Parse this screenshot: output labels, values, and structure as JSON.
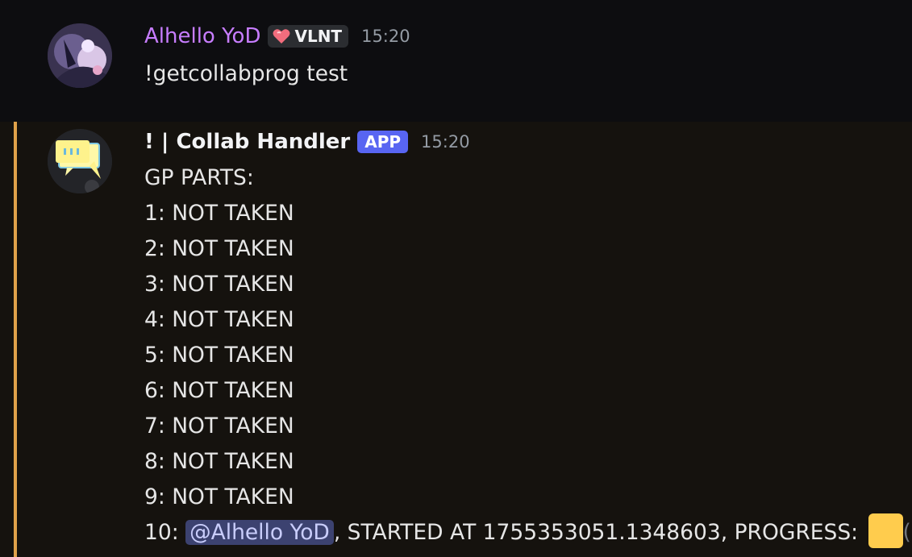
{
  "messages": [
    {
      "username": "Alhello YoD",
      "tag": "VLNT",
      "tag_icon": "heart-icon",
      "time": "15:20",
      "text": "!getcollabprog test"
    },
    {
      "username": "! | Collab Handler",
      "badge": "APP",
      "time": "15:20",
      "lines": [
        "GP PARTS:",
        "1: NOT TAKEN",
        "2: NOT TAKEN",
        "3: NOT TAKEN",
        "4: NOT TAKEN",
        "5: NOT TAKEN",
        "6: NOT TAKEN",
        "7: NOT TAKEN",
        "8: NOT TAKEN",
        "9: NOT TAKEN"
      ],
      "last_line": {
        "prefix": "10: ",
        "mention": "@Alhello YoD",
        "middle": ", STARTED AT 1755353051.1348603, PROGRESS: ",
        "emoji": "yellow-square",
        "trailing": "("
      }
    }
  ],
  "colors": {
    "accent_bar": "#e0a24a",
    "username_purple": "#c77dff",
    "app_badge": "#5865f2",
    "mention_bg": "#3c4270",
    "progress_square": "#ffcc4d"
  }
}
